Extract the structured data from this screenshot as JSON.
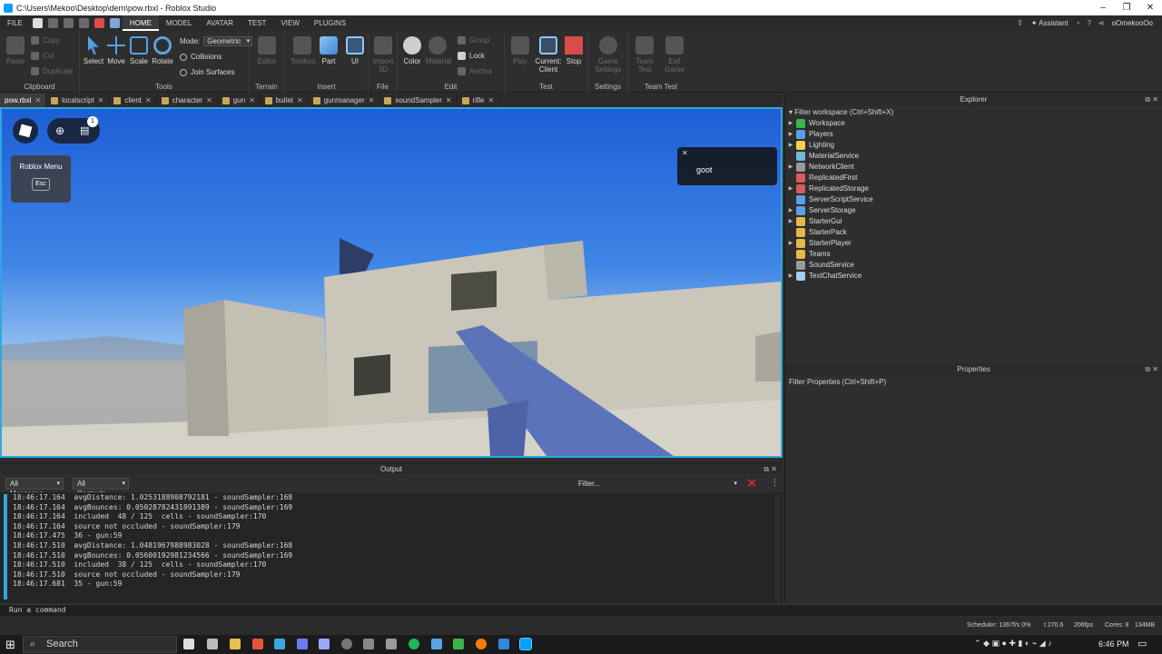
{
  "window": {
    "title": "C:\\Users\\Mekoo\\Desktop\\dern\\pow.rbxl - Roblox Studio",
    "controls": [
      "–",
      "❐",
      "✕"
    ]
  },
  "menubar": {
    "tabs": [
      "FILE",
      "HOME",
      "MODEL",
      "AVATAR",
      "TEST",
      "VIEW",
      "PLUGINS"
    ],
    "active_tab": "HOME",
    "assistant_label": "Assistant",
    "username": "oOmekooOo"
  },
  "ribbon": {
    "clipboard": {
      "title": "Clipboard",
      "paste": "Paste",
      "copy": "Copy",
      "cut": "Cut",
      "duplicate": "Duplicate"
    },
    "tools": {
      "title": "Tools",
      "select": "Select",
      "move": "Move",
      "scale": "Scale",
      "rotate": "Rotate",
      "mode_label": "Mode:",
      "mode_value": "Geometric",
      "collisions": "Collisions",
      "join_surfaces": "Join Surfaces"
    },
    "terrain": {
      "title": "Terrain",
      "editor": "Editor"
    },
    "insert": {
      "title": "Insert",
      "toolbox": "Toolbox",
      "part": "Part",
      "ui": "UI"
    },
    "file": {
      "title": "File",
      "import3d_a": "Import",
      "import3d_b": "3D"
    },
    "edit": {
      "title": "Edit",
      "color": "Color",
      "material": "Material",
      "group": "Group",
      "lock": "Lock",
      "anchor": "Anchor"
    },
    "test": {
      "title": "Test",
      "play": "Play",
      "current_client_a": "Current:",
      "current_client_b": "Client",
      "stop": "Stop"
    },
    "settings": {
      "title": "Settings",
      "game_settings_a": "Game",
      "game_settings_b": "Settings"
    },
    "team_test": {
      "title": "Team Test",
      "team_test_a": "Team",
      "team_test_b": "Test",
      "exit_game_a": "Exit",
      "exit_game_b": "Game"
    }
  },
  "doc_tabs": [
    {
      "label": "pow.rbxl",
      "active": true
    },
    {
      "label": "localscript",
      "active": false
    },
    {
      "label": "client",
      "active": false
    },
    {
      "label": "character",
      "active": false
    },
    {
      "label": "gun",
      "active": false
    },
    {
      "label": "bullet",
      "active": false
    },
    {
      "label": "gunmanager",
      "active": false
    },
    {
      "label": "soundSampler",
      "active": false
    },
    {
      "label": "rifle",
      "active": false
    }
  ],
  "viewport": {
    "notification_count": "1",
    "menu_tip_title": "Roblox Menu",
    "menu_tip_key": "Esc",
    "toast_text": "goot",
    "toast_close": "✕"
  },
  "output": {
    "title": "Output",
    "messages_filter": "All Messages",
    "contexts_filter": "All Contexts",
    "filter_placeholder": "Filter...",
    "lines": [
      "18:46:17.164  avgDistance: 1.0253188908792181 - soundSampler:168",
      "18:46:17.164  avgBounces: 0.05028782431891389 - soundSampler:169",
      "18:46:17.164  included  48 / 125  cells - soundSampler:170",
      "18:46:17.164  source not occluded - soundSampler:179",
      "18:46:17.475  36 - gun:59",
      "18:46:17.510  avgDistance: 1.0481967988983028 - soundSampler:168",
      "18:46:17.510  avgBounces: 0.05600192981234566 - soundSampler:169",
      "18:46:17.510  included  38 / 125  cells - soundSampler:170",
      "18:46:17.510  source not occluded - soundSampler:179",
      "18:46:17.681  35 - gun:59"
    ]
  },
  "command_bar": {
    "placeholder": "Run a command"
  },
  "explorer": {
    "title": "Explorer",
    "filter_placeholder": "Filter workspace (Ctrl+Shift+X)",
    "items": [
      {
        "label": "Workspace",
        "expandable": true,
        "icon_color": "#3cb44b"
      },
      {
        "label": "Players",
        "expandable": true,
        "icon_color": "#5aa0e6"
      },
      {
        "label": "Lighting",
        "expandable": true,
        "icon_color": "#f2d34a"
      },
      {
        "label": "MaterialService",
        "expandable": false,
        "icon_color": "#6fb8d8"
      },
      {
        "label": "NetworkClient",
        "expandable": true,
        "icon_color": "#9a9a9a"
      },
      {
        "label": "ReplicatedFirst",
        "expandable": false,
        "icon_color": "#d95b5b"
      },
      {
        "label": "ReplicatedStorage",
        "expandable": true,
        "icon_color": "#d95b5b"
      },
      {
        "label": "ServerScriptService",
        "expandable": false,
        "icon_color": "#5aa0e6"
      },
      {
        "label": "ServerStorage",
        "expandable": true,
        "icon_color": "#5aa0e6"
      },
      {
        "label": "StarterGui",
        "expandable": true,
        "icon_color": "#e6b84a"
      },
      {
        "label": "StarterPack",
        "expandable": false,
        "icon_color": "#e6b84a"
      },
      {
        "label": "StarterPlayer",
        "expandable": true,
        "icon_color": "#e6b84a"
      },
      {
        "label": "Teams",
        "expandable": false,
        "icon_color": "#e6b84a"
      },
      {
        "label": "SoundService",
        "expandable": false,
        "icon_color": "#9a9a9a"
      },
      {
        "label": "TextChatService",
        "expandable": true,
        "icon_color": "#9fd0ef"
      }
    ]
  },
  "properties": {
    "title": "Properties",
    "filter_placeholder": "Filter Properties (Ctrl+Shift+P)"
  },
  "statusbar": {
    "scheduler": "Scheduler: 1367f/s 0%",
    "t": "t 270.6",
    "fps": "206fps",
    "cores": "Cores: 8",
    "memory": "134MB"
  },
  "taskbar": {
    "search_label": "Search",
    "time": "6:46 PM"
  },
  "colors": {
    "accent_blue": "#2fa7e0",
    "stop_red": "#d94c4c",
    "error_x": "#e03030"
  }
}
